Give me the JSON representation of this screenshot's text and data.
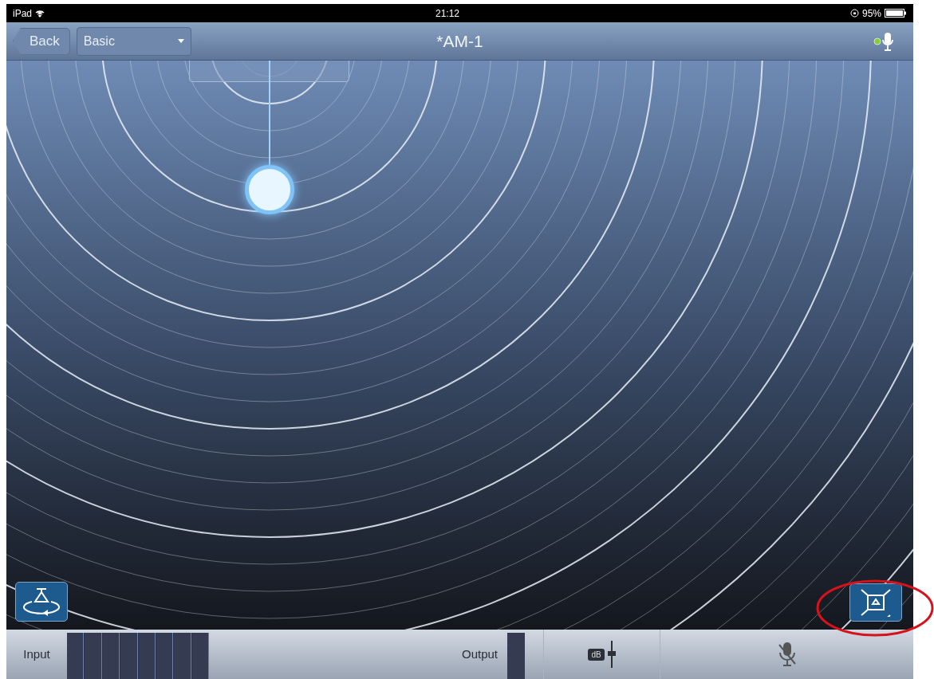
{
  "status_bar": {
    "device": "iPad",
    "time": "21:12",
    "battery": "95%"
  },
  "nav_bar": {
    "back": "Back",
    "preset": "Basic",
    "title": "*AM-1"
  },
  "toolbar": {
    "input_label": "Input",
    "output_label": "Output",
    "db_badge": "dB"
  }
}
